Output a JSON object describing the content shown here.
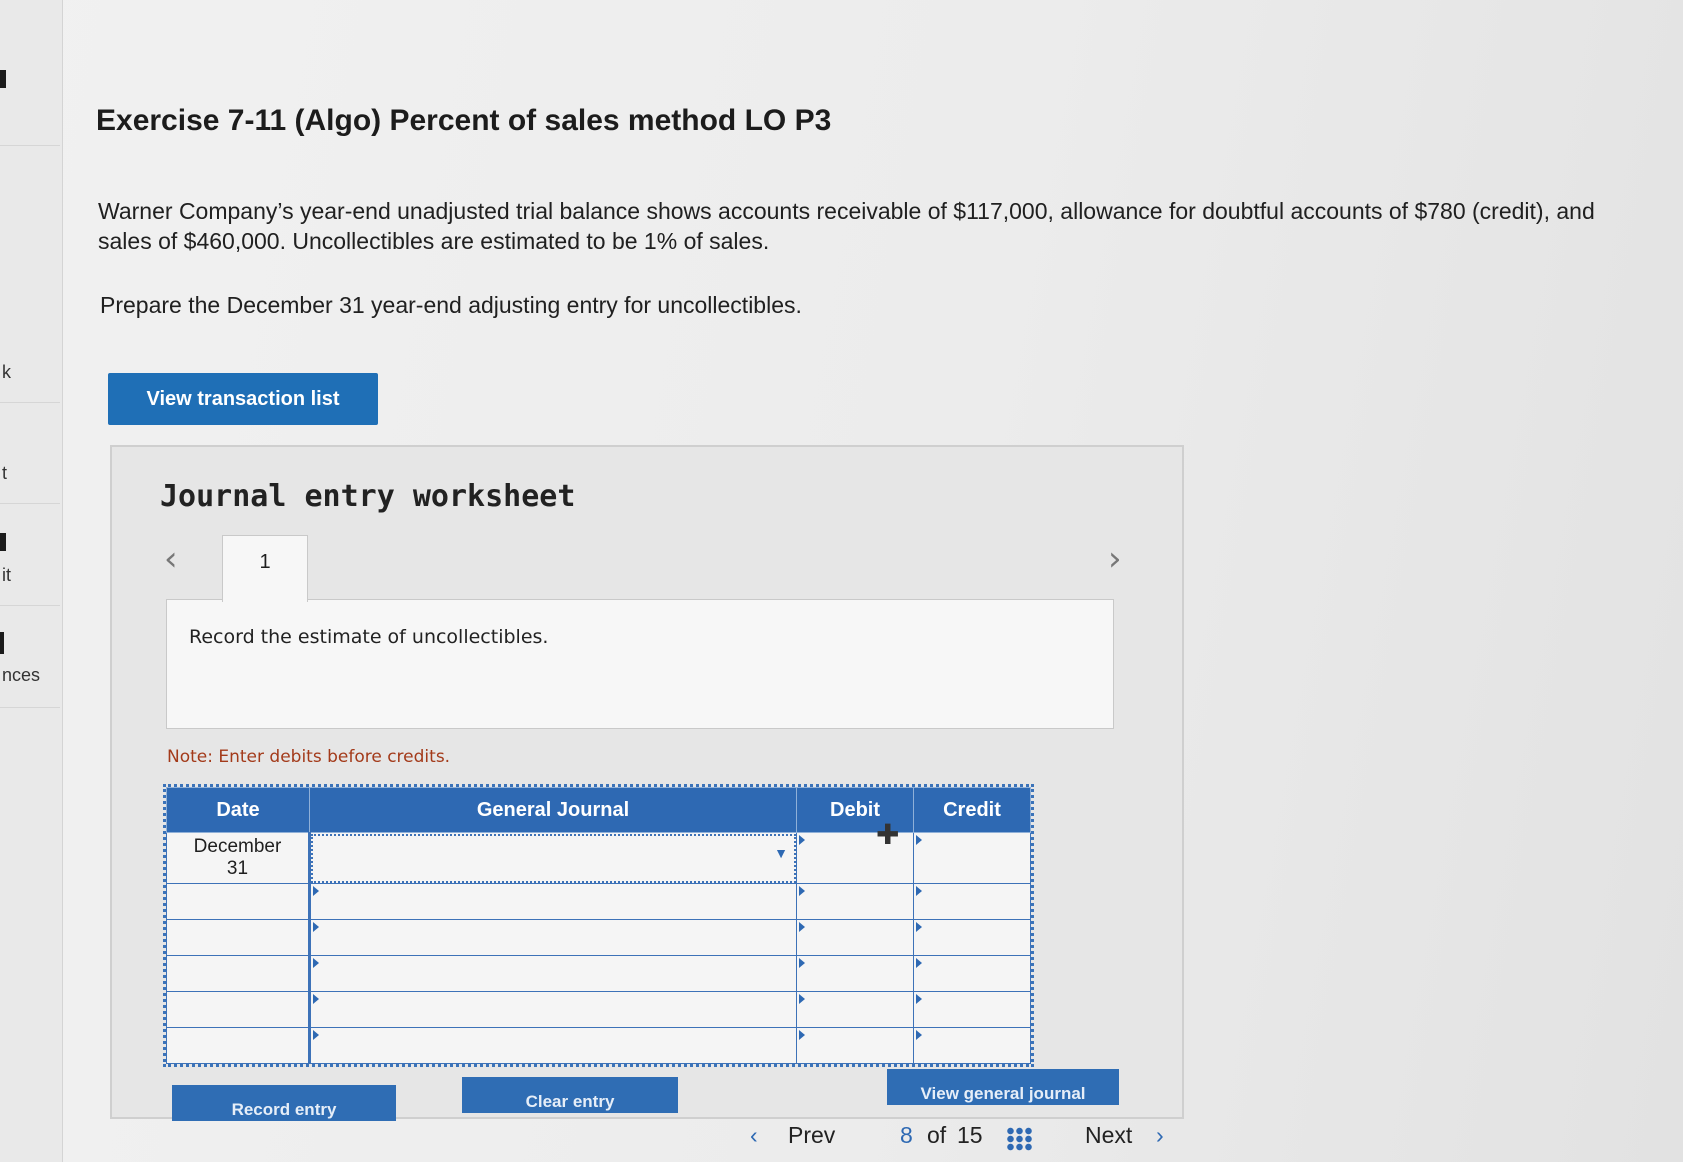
{
  "sidebar": {
    "items": [
      "k",
      "t",
      "it",
      "nces"
    ]
  },
  "exercise": {
    "title": "Exercise 7-11 (Algo) Percent of sales method LO P3",
    "prompt": "Warner Company’s year-end unadjusted trial balance shows accounts receivable of $117,000, allowance for doubtful accounts of $780 (credit), and sales of $460,000. Uncollectibles are estimated to be 1% of sales.",
    "instruction": "Prepare the December 31 year-end adjusting entry for uncollectibles."
  },
  "buttons": {
    "view_transaction_list": "View transaction list",
    "record_entry": "Record entry",
    "clear_entry": "Clear entry",
    "view_general_journal": "View general journal"
  },
  "worksheet": {
    "title": "Journal entry worksheet",
    "tab_number": "1",
    "description": "Record the estimate of uncollectibles.",
    "note": "Note: Enter debits before credits."
  },
  "journal": {
    "headers": {
      "date": "Date",
      "general_journal": "General Journal",
      "debit": "Debit",
      "credit": "Credit"
    },
    "rows": [
      {
        "date": "December\n31",
        "account": "",
        "debit": "",
        "credit": ""
      },
      {
        "date": "",
        "account": "",
        "debit": "",
        "credit": ""
      },
      {
        "date": "",
        "account": "",
        "debit": "",
        "credit": ""
      },
      {
        "date": "",
        "account": "",
        "debit": "",
        "credit": ""
      },
      {
        "date": "",
        "account": "",
        "debit": "",
        "credit": ""
      },
      {
        "date": "",
        "account": "",
        "debit": "",
        "credit": ""
      }
    ]
  },
  "pagination": {
    "prev": "Prev",
    "current": "8",
    "of": "of",
    "total": "15",
    "next": "Next"
  },
  "icons": {
    "prev_tab": "chevron-left-icon",
    "next_tab": "chevron-right-icon",
    "dropdown": "caret-down-icon",
    "grid": "grid-icon"
  },
  "colors": {
    "primary": "#1f6fb6",
    "table_header": "#2e69b3",
    "note": "#a33a1a"
  }
}
